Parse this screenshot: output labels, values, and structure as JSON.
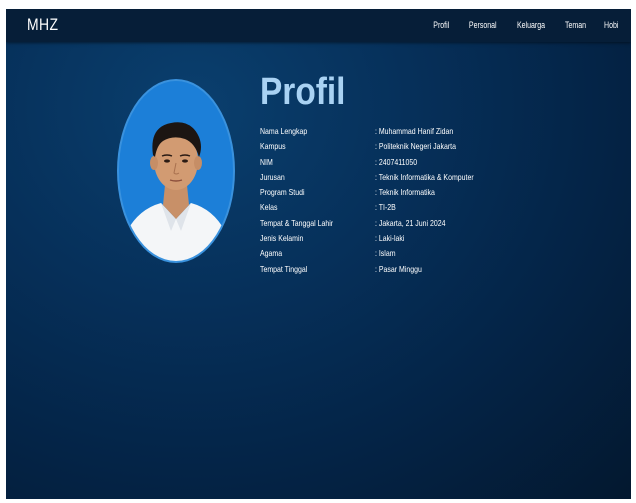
{
  "navbar": {
    "brand": "MHZ",
    "links": [
      "Profil",
      "Personal",
      "Keluarga",
      "Teman",
      "Hobi"
    ]
  },
  "profile": {
    "title": "Profil",
    "rows": [
      {
        "label": "Nama Lengkap",
        "value": ": Muhammad Hanif Zidan"
      },
      {
        "label": "Kampus",
        "value": ": Politeknik Negeri Jakarta"
      },
      {
        "label": "NIM",
        "value": ": 2407411050"
      },
      {
        "label": "Jurusan",
        "value": ": Teknik Informatika & Komputer"
      },
      {
        "label": "Program Studi",
        "value": ": Teknik Informatika"
      },
      {
        "label": "Kelas",
        "value": ": TI-2B"
      },
      {
        "label": "Tempat & Tanggal Lahir",
        "value": ": Jakarta, 21 Juni 2024"
      },
      {
        "label": "Jenis Kelamin",
        "value": ": Laki-laki"
      },
      {
        "label": "Agama",
        "value": ": Islam"
      },
      {
        "label": "Tempat Tinggal",
        "value": ": Pasar Minggu"
      }
    ]
  },
  "colors": {
    "background": "#042447",
    "navbar": "#061e38",
    "title": "#a9d2f3",
    "avatar_bg": "#1c7fd8"
  }
}
